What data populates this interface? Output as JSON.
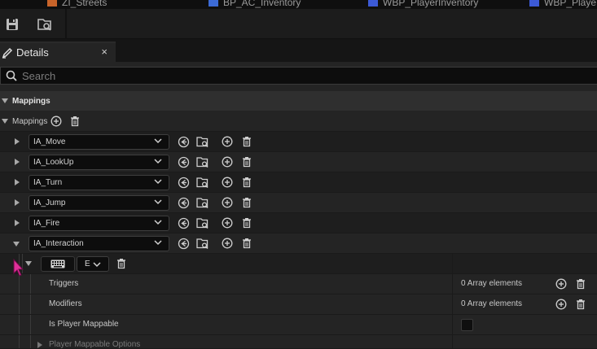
{
  "doc_tabs": [
    {
      "label": "ZI_Streets",
      "icon": "blueprint-icon"
    },
    {
      "label": "BP_AC_Inventory",
      "icon": "blueprint-icon"
    },
    {
      "label": "WBP_PlayerInventory",
      "icon": "widget-blueprint-icon"
    },
    {
      "label": "WBP_Playe",
      "icon": "widget-blueprint-icon"
    }
  ],
  "toolbar": {
    "save_icon": "save-icon",
    "browse_icon": "browse-in-content-browser-icon"
  },
  "details_tab": {
    "label": "Details",
    "close": "×",
    "icon": "pencil-icon"
  },
  "search": {
    "placeholder": "Search"
  },
  "section": {
    "label": "Mappings"
  },
  "mappings_array": {
    "label": "Mappings"
  },
  "mappings": [
    {
      "action": "IA_Move",
      "expanded": false
    },
    {
      "action": "IA_LookUp",
      "expanded": false
    },
    {
      "action": "IA_Turn",
      "expanded": false
    },
    {
      "action": "IA_Jump",
      "expanded": false
    },
    {
      "action": "IA_Fire",
      "expanded": false
    },
    {
      "action": "IA_Interaction",
      "expanded": true
    }
  ],
  "key_row": {
    "key_icon": "keyboard-icon",
    "key_value": "E"
  },
  "properties": [
    {
      "label": "Triggers",
      "value": "0 Array elements"
    },
    {
      "label": "Modifiers",
      "value": "0 Array elements"
    },
    {
      "label": "Is Player Mappable",
      "value": ""
    },
    {
      "label": "Player Mappable Options",
      "value": ""
    }
  ],
  "colors": {
    "panel_bg": "#242424",
    "row_dark": "#1e1e1e",
    "input_bg": "#0d0d0d",
    "cursor": "#e0309a",
    "blueprint_accent": "#3c6bd6"
  }
}
